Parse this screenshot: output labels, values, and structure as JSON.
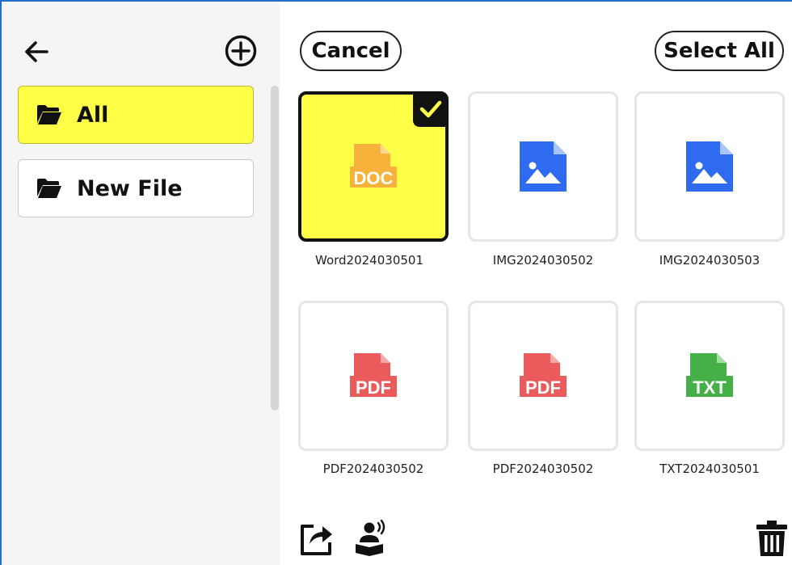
{
  "sidebar": {
    "folders": [
      {
        "label": "All",
        "icon": "folder-open-icon",
        "active": true
      },
      {
        "label": "New File",
        "icon": "folder-open-icon",
        "active": false
      }
    ]
  },
  "toolbar": {
    "cancel_label": "Cancel",
    "select_all_label": "Select All"
  },
  "files": [
    {
      "name": "Word2024030501",
      "type": "DOC",
      "selected": true
    },
    {
      "name": "IMG2024030502",
      "type": "IMG",
      "selected": false
    },
    {
      "name": "IMG2024030503",
      "type": "IMG",
      "selected": false
    },
    {
      "name": "PDF2024030502",
      "type": "PDF",
      "selected": false
    },
    {
      "name": "PDF2024030502",
      "type": "PDF",
      "selected": false
    },
    {
      "name": "TXT2024030501",
      "type": "TXT",
      "selected": false
    }
  ],
  "icons": {
    "doc_label": "DOC",
    "pdf_label": "PDF",
    "txt_label": "TXT"
  },
  "colors": {
    "selected_bg": "#ffff47",
    "doc_orange": "#f7b23b",
    "img_blue": "#2f6bf0",
    "pdf_red": "#ec5b5b",
    "txt_green": "#45b048",
    "frame_blue": "#1f6fd1"
  }
}
